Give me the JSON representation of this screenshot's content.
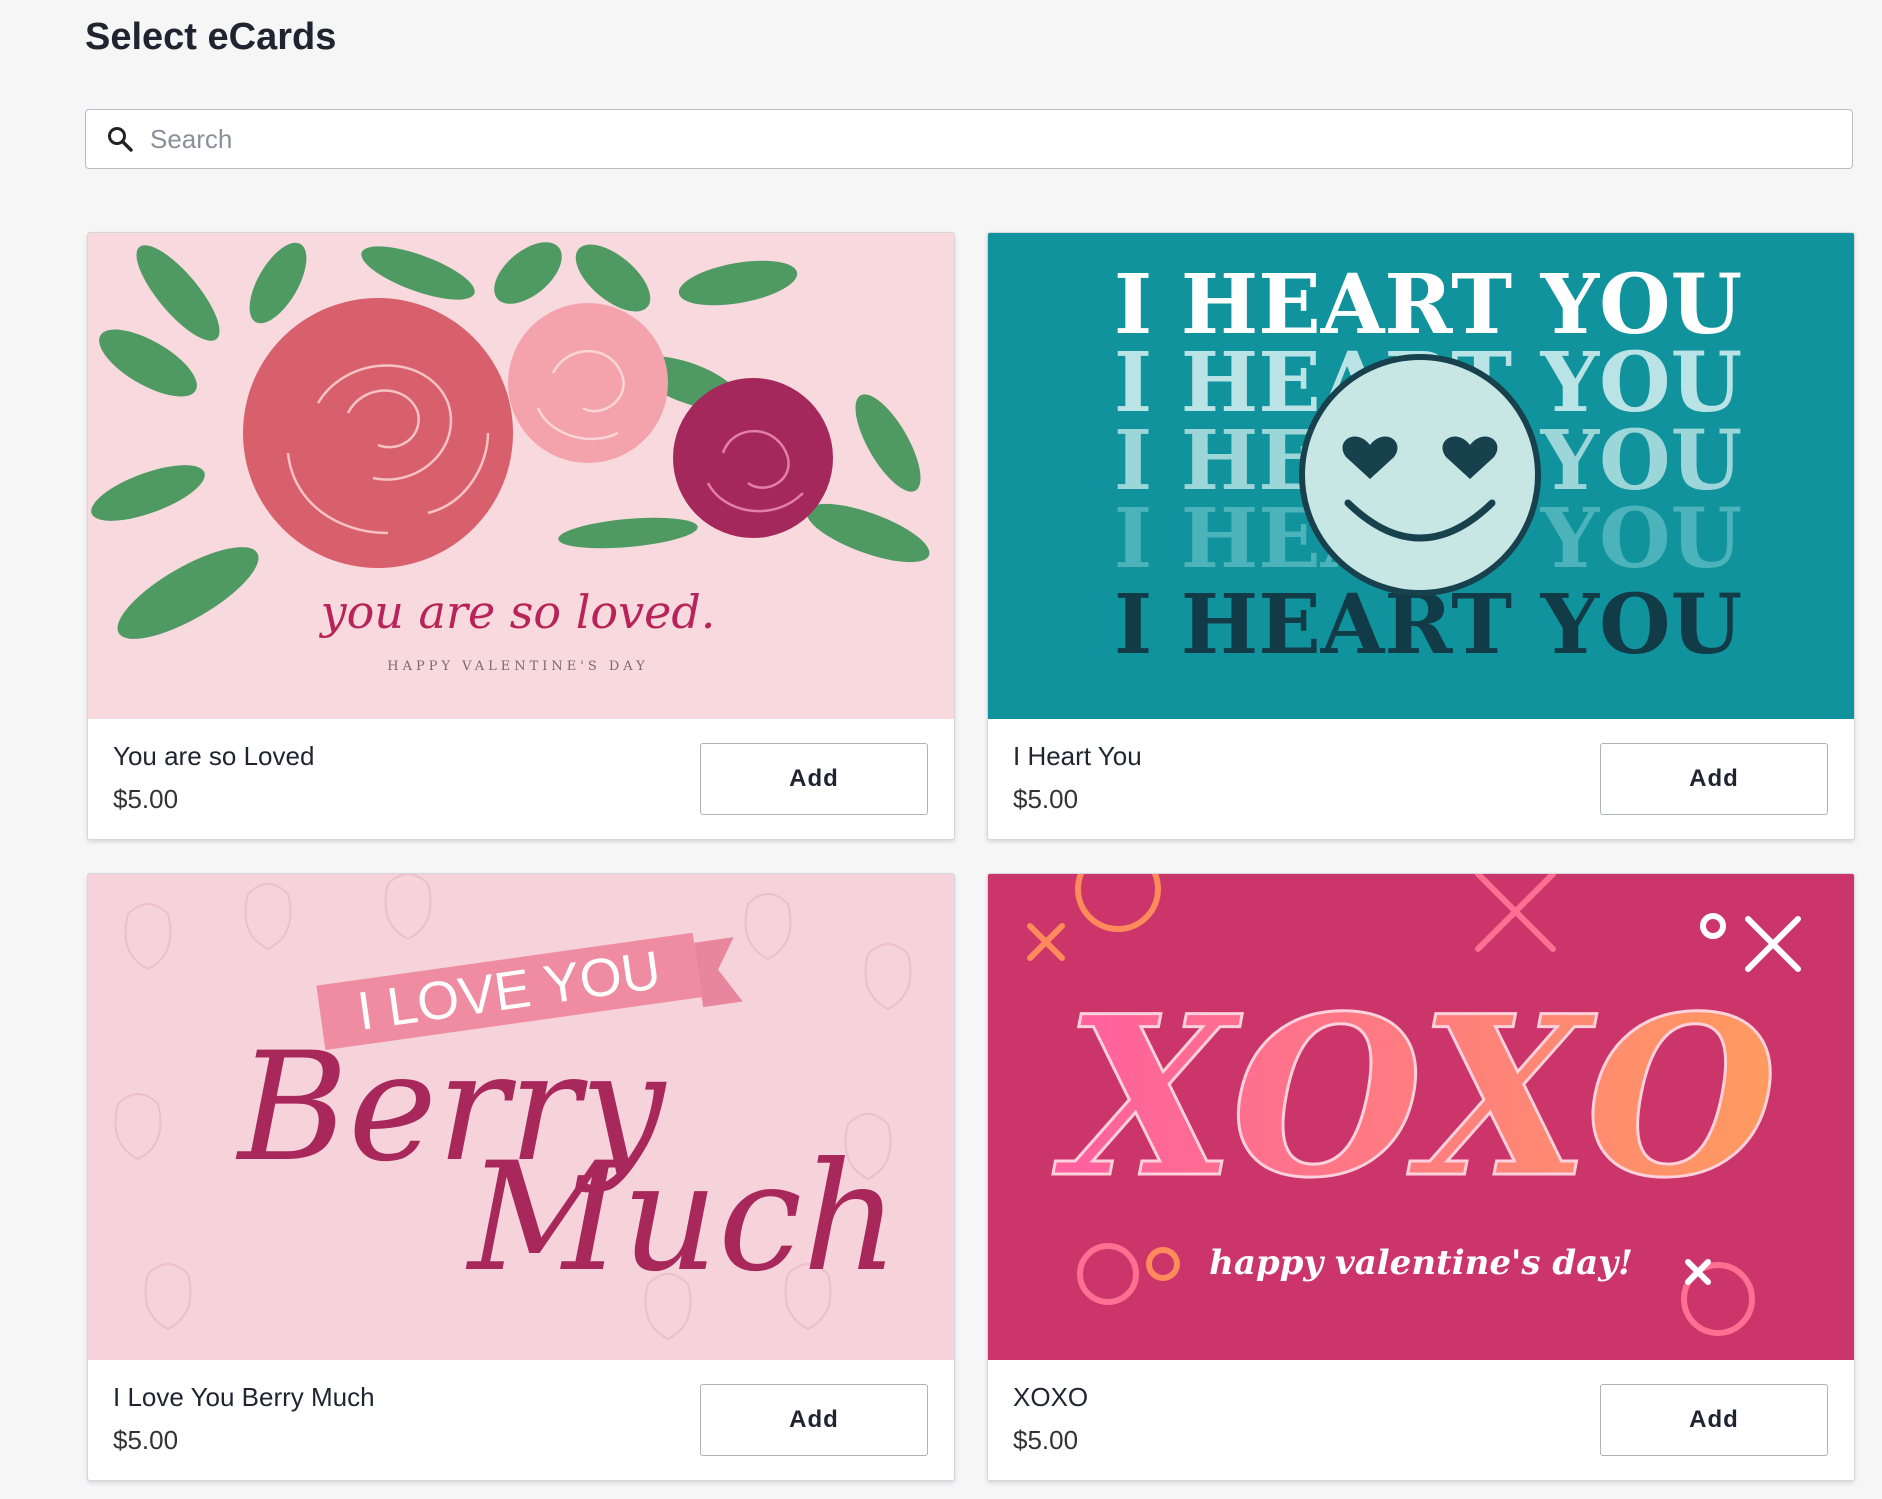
{
  "page": {
    "title": "Select eCards"
  },
  "search": {
    "placeholder": "Search",
    "value": ""
  },
  "cards": [
    {
      "name": "You are so Loved",
      "price": "$5.00",
      "add_label": "Add",
      "art": {
        "headline": "you are so loved.",
        "subline": "HAPPY VALENTINE'S DAY",
        "background": "#f7d9de"
      }
    },
    {
      "name": "I Heart You",
      "price": "$5.00",
      "add_label": "Add",
      "art": {
        "line": "I HEART YOU",
        "background": "#10939c"
      }
    },
    {
      "name": "I Love You Berry Much",
      "price": "$5.00",
      "add_label": "Add",
      "art": {
        "banner": "I LOVE YOU",
        "word1": "Berry",
        "word2": "Much",
        "background": "#f6d3da"
      }
    },
    {
      "name": "XOXO",
      "price": "$5.00",
      "add_label": "Add",
      "art": {
        "headline": "XOXO",
        "subline": "happy valentine's day!",
        "background": "#cc3569"
      }
    }
  ]
}
